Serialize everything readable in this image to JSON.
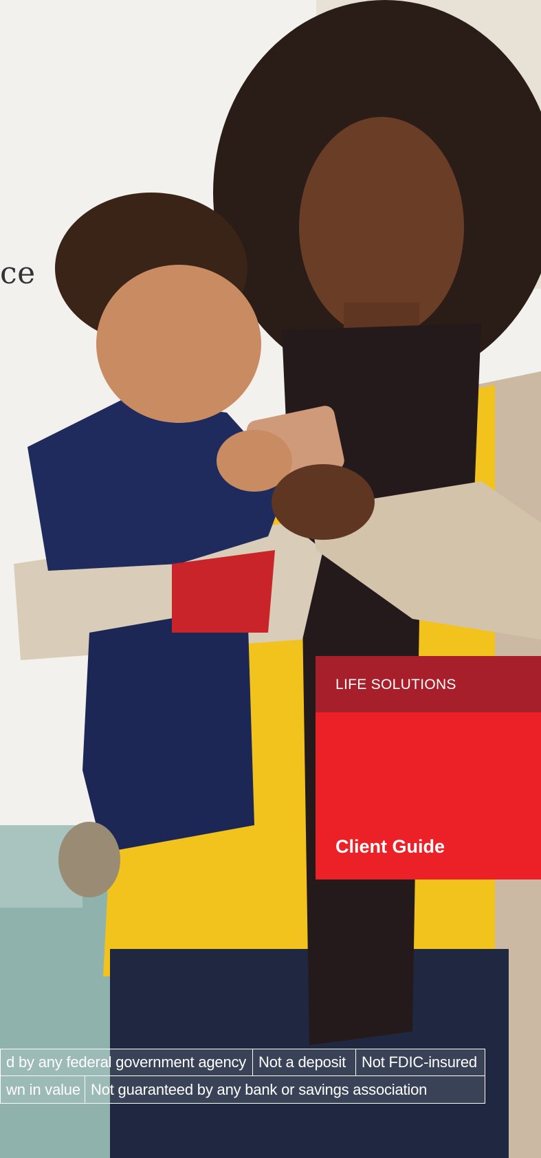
{
  "cover": {
    "title_fragment": "ce",
    "section_label": "LIFE SOLUTIONS",
    "guide_label": "Client Guide"
  },
  "disclaimer": {
    "row1": [
      "d by any federal government agency",
      "Not a deposit",
      "Not FDIC-insured"
    ],
    "row2": [
      "wn in value",
      "Not guaranteed by any bank or savings association"
    ]
  },
  "colors": {
    "header_red": "#a71f2a",
    "panel_red": "#ec2027",
    "shirt_yellow": "#f2c31c",
    "hoodie_navy": "#1e2b5c"
  }
}
